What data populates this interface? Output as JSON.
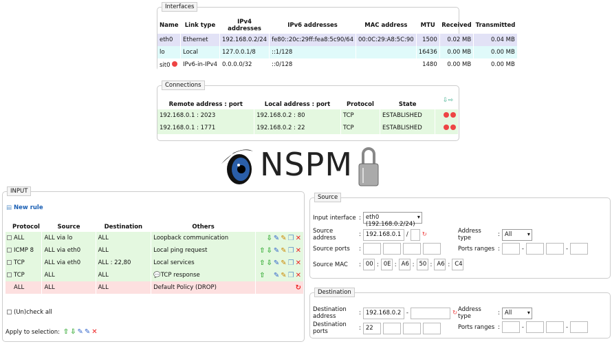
{
  "interfaces": {
    "title": "Interfaces",
    "headers": [
      "Name",
      "Link type",
      "IPv4 addresses",
      "IPv6 addresses",
      "MAC address",
      "MTU",
      "Received",
      "Transmitted"
    ],
    "rows": [
      [
        "eth0",
        "Ethernet",
        "192.168.0.2/24",
        "fe80::20c:29ff:fea8:5c90/64",
        "00:0C:29:A8:5C:90",
        "1500",
        "0.02 MB",
        "0.04 MB"
      ],
      [
        "lo",
        "Local",
        "127.0.0.1/8",
        "::1/128",
        "",
        "16436",
        "0.00 MB",
        "0.00 MB"
      ],
      [
        "sit0",
        "IPv6-in-IPv4",
        "0.0.0.0/32",
        "::0/128",
        "",
        "1480",
        "0.00 MB",
        "0.00 MB"
      ]
    ]
  },
  "connections": {
    "title": "Connections",
    "headers": [
      "Remote address : port",
      "Local address : port",
      "Protocol",
      "State"
    ],
    "rows": [
      [
        "192.168.0.1 : 2023",
        "192.168.0.2 : 80",
        "TCP",
        "ESTABLISHED"
      ],
      [
        "192.168.0.1 : 1771",
        "192.168.0.2 : 22",
        "TCP",
        "ESTABLISHED"
      ]
    ]
  },
  "logo": {
    "text": "NSPM"
  },
  "input": {
    "title": "INPUT",
    "new_rule": "New rule",
    "headers": [
      "Protocol",
      "Source",
      "Destination",
      "Others"
    ],
    "rows": [
      [
        "ALL",
        "ALL via lo",
        "ALL",
        "Loopback communication"
      ],
      [
        "ICMP 8",
        "ALL via eth0",
        "ALL",
        "Local ping request"
      ],
      [
        "TCP",
        "ALL via eth0",
        "ALL : 22,80",
        "Local services"
      ],
      [
        "TCP",
        "ALL",
        "ALL",
        "TCP response"
      ],
      [
        "ALL",
        "ALL",
        "ALL",
        "Default Policy (DROP)"
      ]
    ],
    "uncheck_all": "(Un)check all",
    "apply": "Apply to selection:"
  },
  "source": {
    "title": "Source",
    "input_interface_label": "Input interface",
    "input_interface": "eth0 (192.168.0.2/24)",
    "address_label": "Source address",
    "address": "192.168.0.1",
    "address_type_label": "Address type",
    "address_type": "All",
    "ports_label": "Source ports",
    "ports_ranges_label": "Ports ranges",
    "mac_label": "Source MAC",
    "mac": [
      "00",
      "0E",
      "A6",
      "50",
      "A6",
      "C4"
    ]
  },
  "destination": {
    "title": "Destination",
    "address_label": "Destination address",
    "address": "192.168.0.2",
    "address_type_label": "Address type",
    "address_type": "All",
    "ports_label": "Destination ports",
    "port1": "22",
    "ports_ranges_label": "Ports ranges"
  },
  "sep": {
    "colon": ":",
    "dash": "-",
    "slash": "/"
  }
}
